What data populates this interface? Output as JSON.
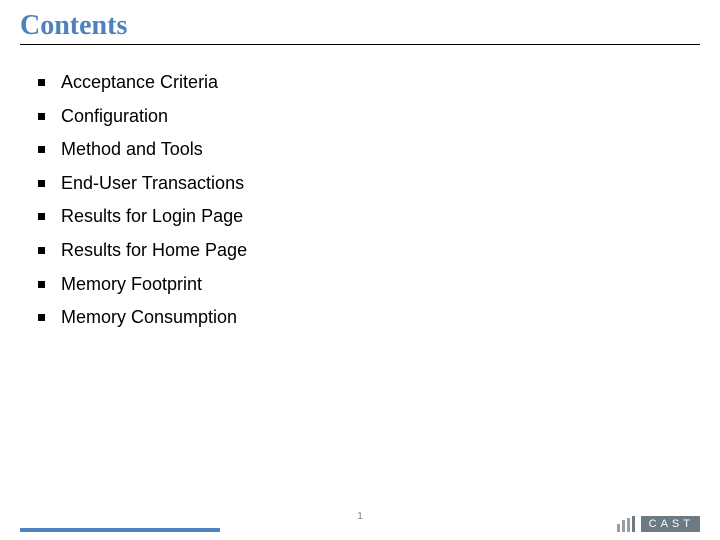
{
  "title": "Contents",
  "toc": [
    "Acceptance Criteria",
    "Configuration",
    "Method and Tools",
    "End-User Transactions",
    "Results for Login Page",
    "Results for Home Page",
    "Memory Footprint",
    "Memory Consumption"
  ],
  "page_number": "1",
  "logo_text": "CAST"
}
